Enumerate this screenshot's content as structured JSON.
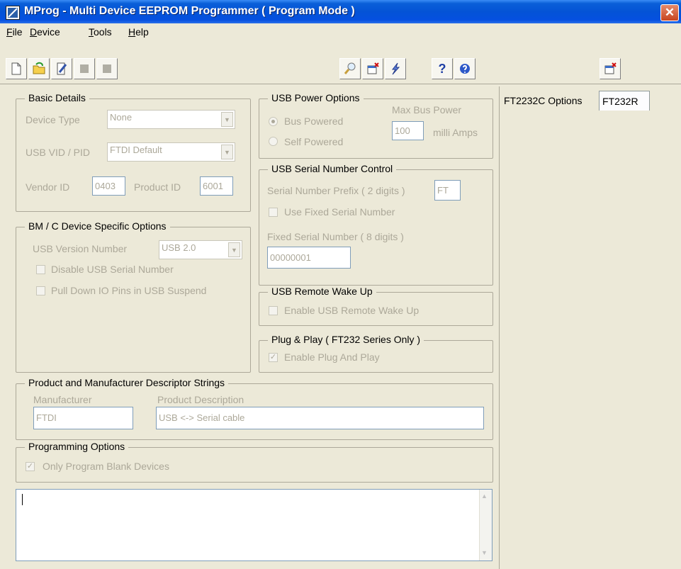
{
  "window": {
    "title": "MProg - Multi Device EEPROM Programmer ( Program Mode )",
    "close_glyph": "✕"
  },
  "menu": [
    "File",
    "Device",
    "Tools",
    "Help"
  ],
  "toolbar": {
    "buttons": [
      "new-file-icon",
      "open-folder-icon",
      "edit-icon",
      "disabled-icon",
      "disabled-icon",
      "search-icon",
      "close-window-icon",
      "lightning-icon",
      "help-icon",
      "info-icon",
      "close-window-icon"
    ],
    "help_glyph": "?"
  },
  "basic_details": {
    "title": "Basic Details",
    "device_type_label": "Device Type",
    "device_type_value": "None",
    "vid_pid_label": "USB VID / PID",
    "vid_pid_value": "FTDI Default",
    "vendor_id_label": "Vendor ID",
    "vendor_id_value": "0403",
    "product_id_label": "Product ID",
    "product_id_value": "6001"
  },
  "bm_options": {
    "title": "BM / C Device Specific Options",
    "usb_version_label": "USB Version Number",
    "usb_version_value": "USB 2.0",
    "disable_serial_label": "Disable USB Serial Number",
    "pull_down_label": "Pull Down IO Pins in USB Suspend"
  },
  "power_options": {
    "title": "USB Power Options",
    "bus_powered": "Bus Powered",
    "self_powered": "Self Powered",
    "max_bus_power_label": "Max Bus Power",
    "max_bus_power_value": "100",
    "unit": "milli Amps"
  },
  "serial_control": {
    "title": "USB Serial Number Control",
    "prefix_label": "Serial Number Prefix ( 2 digits )",
    "prefix_value": "FT",
    "use_fixed_label": "Use Fixed Serial Number",
    "fixed_label": "Fixed Serial Number ( 8 digits )",
    "fixed_value": "00000001"
  },
  "remote_wakeup": {
    "title": "USB Remote Wake Up",
    "enable_label": "Enable USB Remote Wake Up"
  },
  "plug_play": {
    "title": "Plug & Play  ( FT232 Series Only )",
    "enable_label": "Enable Plug And Play"
  },
  "descriptors": {
    "title": "Product and Manufacturer Descriptor Strings",
    "manufacturer_label": "Manufacturer",
    "manufacturer_value": "FTDI",
    "product_label": "Product Description",
    "product_value": "USB <-> Serial cable"
  },
  "programming": {
    "title": "Programming Options",
    "only_blank_label": "Only Program Blank Devices"
  },
  "tabs": [
    "FT2232C Options",
    "FT232R"
  ],
  "colors": {
    "title_bar": "#0453d6",
    "window_bg": "#ece9d8",
    "disabled_text": "#aca899",
    "close_button": "#c8451f"
  }
}
